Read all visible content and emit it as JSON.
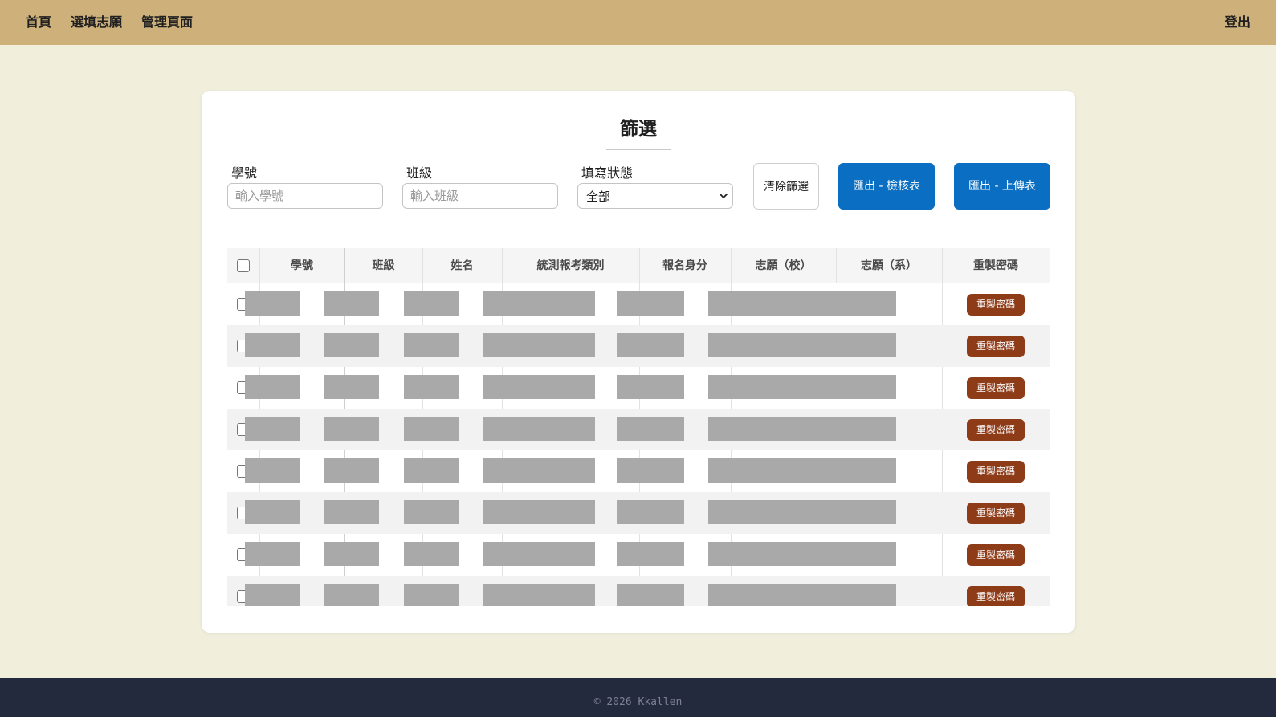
{
  "nav": {
    "home": "首頁",
    "choose": "選填志願",
    "admin": "管理頁面",
    "logout": "登出"
  },
  "filter": {
    "title": "篩選",
    "student_id_label": "學號",
    "student_id_placeholder": "輸入學號",
    "student_id_value": "",
    "class_label": "班級",
    "class_placeholder": "輸入班級",
    "class_value": "",
    "status_label": "填寫狀態",
    "status_selected": "全部",
    "clear_button": "清除篩選",
    "export_check_button": "匯出 - 檢核表",
    "export_upload_button": "匯出 - 上傳表"
  },
  "table": {
    "columns": [
      "學號",
      "班級",
      "姓名",
      "統測報考類別",
      "報名身分",
      "志願（校）",
      "志願（系）",
      "重製密碼"
    ],
    "rows": [
      {
        "checked": false,
        "redacted": true,
        "reset_label": "重製密碼"
      },
      {
        "checked": false,
        "redacted": true,
        "reset_label": "重製密碼"
      },
      {
        "checked": false,
        "redacted": true,
        "reset_label": "重製密碼"
      },
      {
        "checked": false,
        "redacted": true,
        "reset_label": "重製密碼"
      },
      {
        "checked": false,
        "redacted": true,
        "reset_label": "重製密碼"
      },
      {
        "checked": false,
        "redacted": true,
        "reset_label": "重製密碼"
      },
      {
        "checked": false,
        "redacted": true,
        "reset_label": "重製密碼"
      },
      {
        "checked": false,
        "redacted": true,
        "reset_label": "重製密碼"
      }
    ]
  },
  "footer": {
    "text": "© 2026 Kkallen"
  },
  "colors": {
    "navbar": "#cdb07a",
    "page_background": "#f1eedc",
    "export_button": "#0a6fc2",
    "reset_button": "#8e3b18",
    "footer": "#232a3e",
    "redaction": "#a9a9a9"
  }
}
